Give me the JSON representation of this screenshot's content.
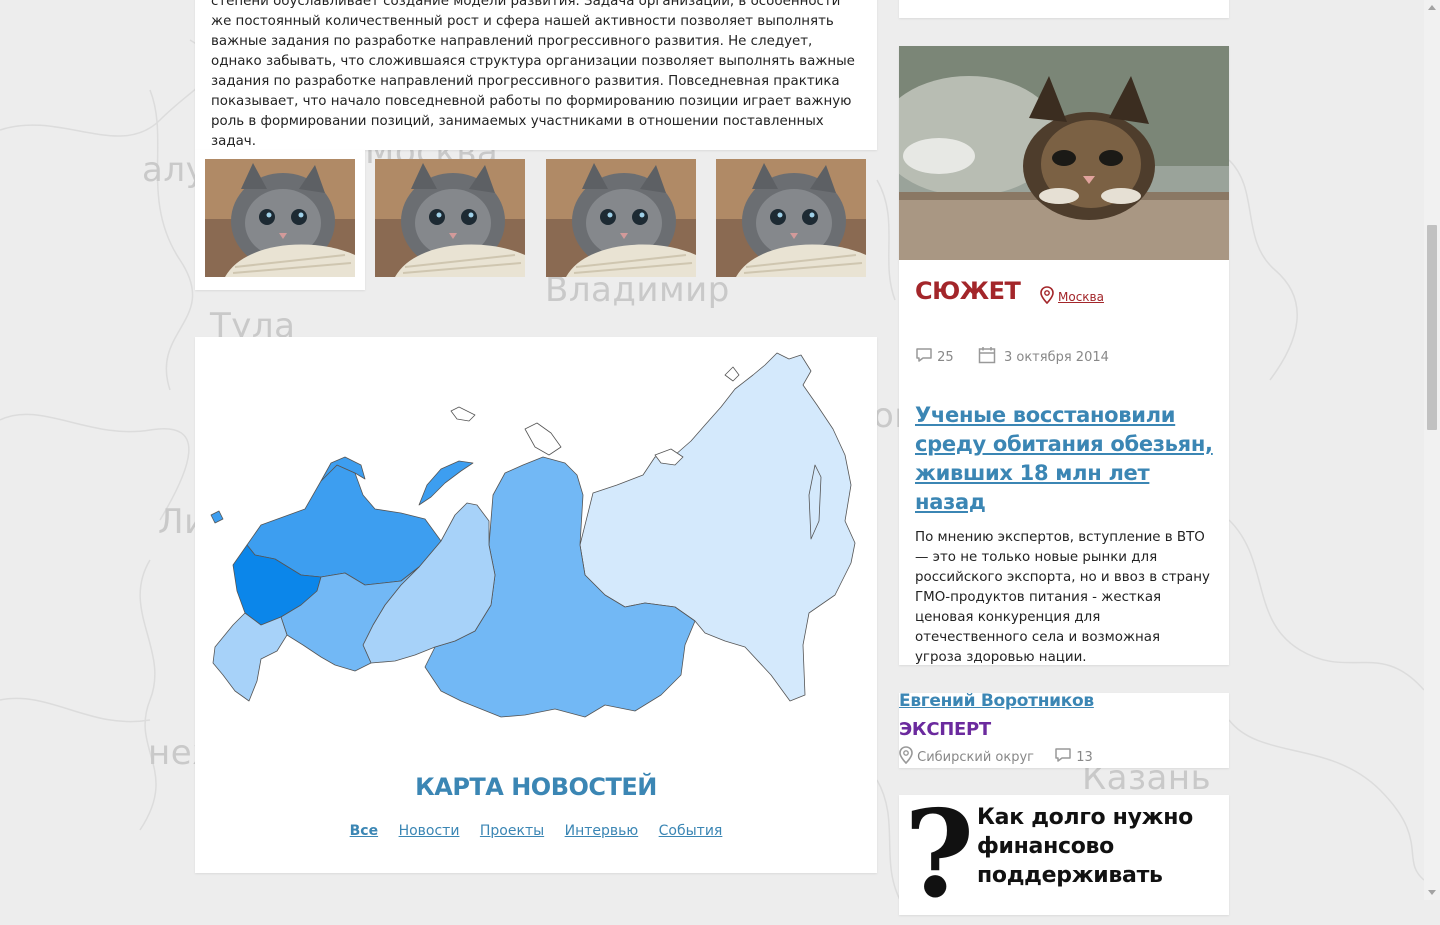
{
  "background_cities": [
    "алу",
    "Москва",
    "Владимир",
    "Тула",
    "Ли",
    "неж",
    "Казань",
    "ого"
  ],
  "article": {
    "text": "степени обуславливает создание модели развития. Задача организации, в особенности же постоянный количественный рост и сфера нашей активности позволяет выполнять важные задания по разработке направлений прогрессивного развития. Не следует, однако забывать, что сложившаяся структура организации позволяет выполнять важные задания по разработке направлений прогрессивного развития. Повседневная практика показывает, что начало повседневной работы по формированию позиции играет важную роль в формировании позиций, занимаемых участниками в отношении поставленных задач."
  },
  "gallery": {
    "count": 4,
    "icon": "kitten-photo"
  },
  "news_map": {
    "title": "КАРТА НОВОСТЕЙ",
    "tabs": [
      {
        "label": "Все",
        "active": true
      },
      {
        "label": "Новости",
        "active": false
      },
      {
        "label": "Проекты",
        "active": false
      },
      {
        "label": "Интервью",
        "active": false
      },
      {
        "label": "События",
        "active": false
      }
    ],
    "colors": [
      "#0b86ea",
      "#3d9ef0",
      "#72b8f5",
      "#a7d2f9",
      "#d4e9fc"
    ]
  },
  "story": {
    "tag": "СЮЖЕТ",
    "location": "Москва",
    "comments": "25",
    "date": "3 октября 2014",
    "headline": "Ученые восстановили среду обитания обезьян, живших 18 млн лет назад",
    "body": "По мнению экспертов, вступление в ВТО — это не только новые рынки для российского экспорта, но и ввоз в страну ГМО-продуктов питания - жесткая ценовая конкуренция для отечественного села и возможная угроза здоровью нации.",
    "accent": "#a3262a"
  },
  "expert": {
    "name": "Евгений Воротников",
    "role": "ЭКСПЕРТ",
    "region": "Сибирский округ",
    "comments": "13"
  },
  "question": {
    "mark": "?",
    "text": "Как долго нужно финансово поддерживать"
  }
}
